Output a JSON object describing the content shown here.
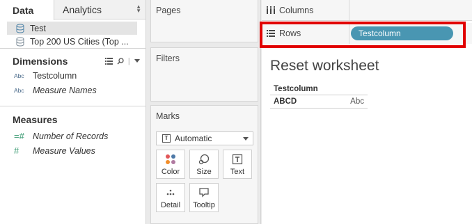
{
  "data_pane": {
    "tabs": [
      {
        "label": "Data"
      },
      {
        "label": "Analytics"
      }
    ],
    "sources": [
      {
        "label": "Test"
      },
      {
        "label": "Top 200 US Cities (Top ..."
      }
    ],
    "dimensions": {
      "title": "Dimensions",
      "fields": [
        {
          "type": "Abc",
          "label": "Testcolumn"
        },
        {
          "type": "Abc",
          "label": "Measure Names"
        }
      ]
    },
    "measures": {
      "title": "Measures",
      "fields": [
        {
          "type": "=#",
          "label": "Number of Records"
        },
        {
          "type": "#",
          "label": "Measure Values"
        }
      ]
    }
  },
  "shelves": {
    "pages_title": "Pages",
    "filters_title": "Filters",
    "marks_title": "Marks",
    "marks_type": "Automatic",
    "mark_buttons": [
      "Color",
      "Size",
      "Text",
      "Detail",
      "Tooltip"
    ]
  },
  "canvas": {
    "columns_label": "Columns",
    "rows_label": "Rows",
    "rows_pill": "Testcolumn",
    "worksheet_title": "Reset worksheet",
    "table": {
      "header": "Testcolumn",
      "rows": [
        {
          "value": "ABCD",
          "placeholder": "Abc"
        }
      ]
    }
  },
  "colors": {
    "pill": "#4996b2",
    "highlight": "#e10000"
  }
}
